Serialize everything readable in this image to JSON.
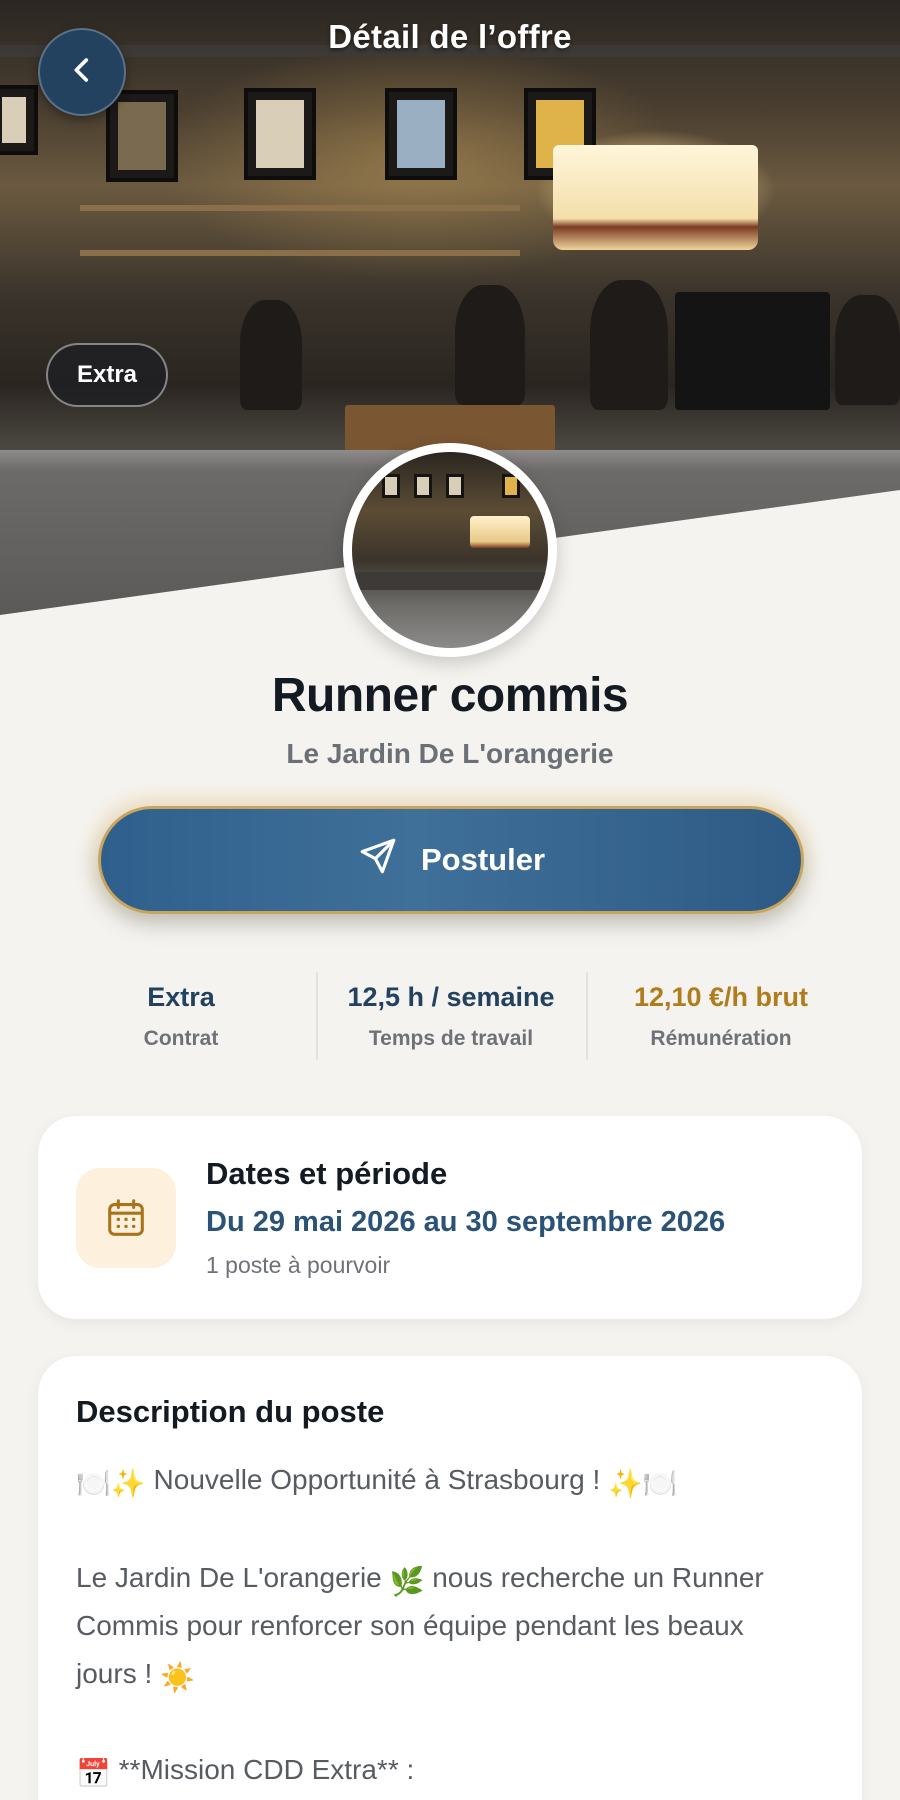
{
  "header": {
    "title": "Détail de l’offre",
    "back_icon": "chevron-left-icon",
    "badge": "Extra"
  },
  "offer": {
    "title": "Runner commis",
    "company": "Le Jardin De L'orangerie",
    "apply_label": "Postuler",
    "apply_icon": "send-icon"
  },
  "stats": [
    {
      "value": "Extra",
      "label": "Contrat"
    },
    {
      "value": "12,5 h / semaine",
      "label": "Temps de travail"
    },
    {
      "value": "12,10 €/h brut",
      "label": "Rémunération"
    }
  ],
  "dates": {
    "title": "Dates et période",
    "range": "Du 29 mai 2026 au 30 septembre 2026",
    "posts": "1 poste à pourvoir",
    "icon": "calendar-icon"
  },
  "description": {
    "title": "Description du poste",
    "line1": "Nouvelle Opportunité à Strasbourg !",
    "line2a": "Le Jardin De L'orangerie",
    "line2b": "nous recherche un Runner",
    "line3": "Commis pour renforcer son équipe pendant les beaux",
    "line4": "jours !",
    "line5": "**Mission CDD Extra** :"
  },
  "colors": {
    "primary": "#2f5f8c",
    "gold": "#b07d1c",
    "background": "#f5f3ef"
  }
}
